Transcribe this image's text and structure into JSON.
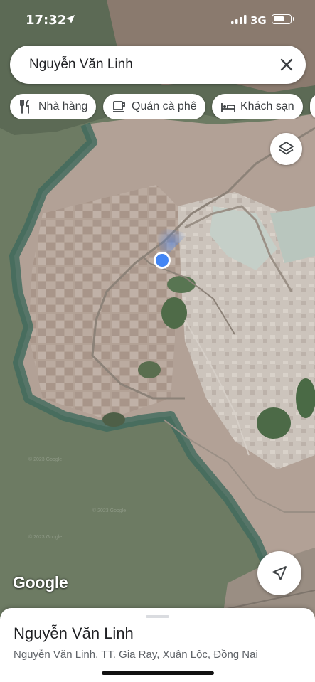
{
  "status_bar": {
    "time": "17:32",
    "network": "3G",
    "icons": [
      "location-arrow-icon",
      "signal-bars-icon",
      "battery-icon"
    ]
  },
  "search": {
    "query": "Nguyễn Văn Linh",
    "close_icon": "close-icon"
  },
  "chips": [
    {
      "label": "Nhà hàng",
      "icon": "restaurant-icon"
    },
    {
      "label": "Quán cà phê",
      "icon": "coffee-icon"
    },
    {
      "label": "Khách sạn",
      "icon": "hotel-icon"
    }
  ],
  "map": {
    "attribution": "Google",
    "watermark": "© 2023 Google",
    "type": "satellite",
    "colors": {
      "water": "#6d7b63",
      "land": "#a8968a",
      "location_dot": "#4285f4"
    }
  },
  "controls": {
    "layers_icon": "layers-icon",
    "navigate_icon": "navigation-arrow-icon"
  },
  "place": {
    "name": "Nguyễn Văn Linh",
    "address": "Nguyễn Văn Linh, TT. Gia Ray, Xuân Lộc, Đồng Nai"
  }
}
